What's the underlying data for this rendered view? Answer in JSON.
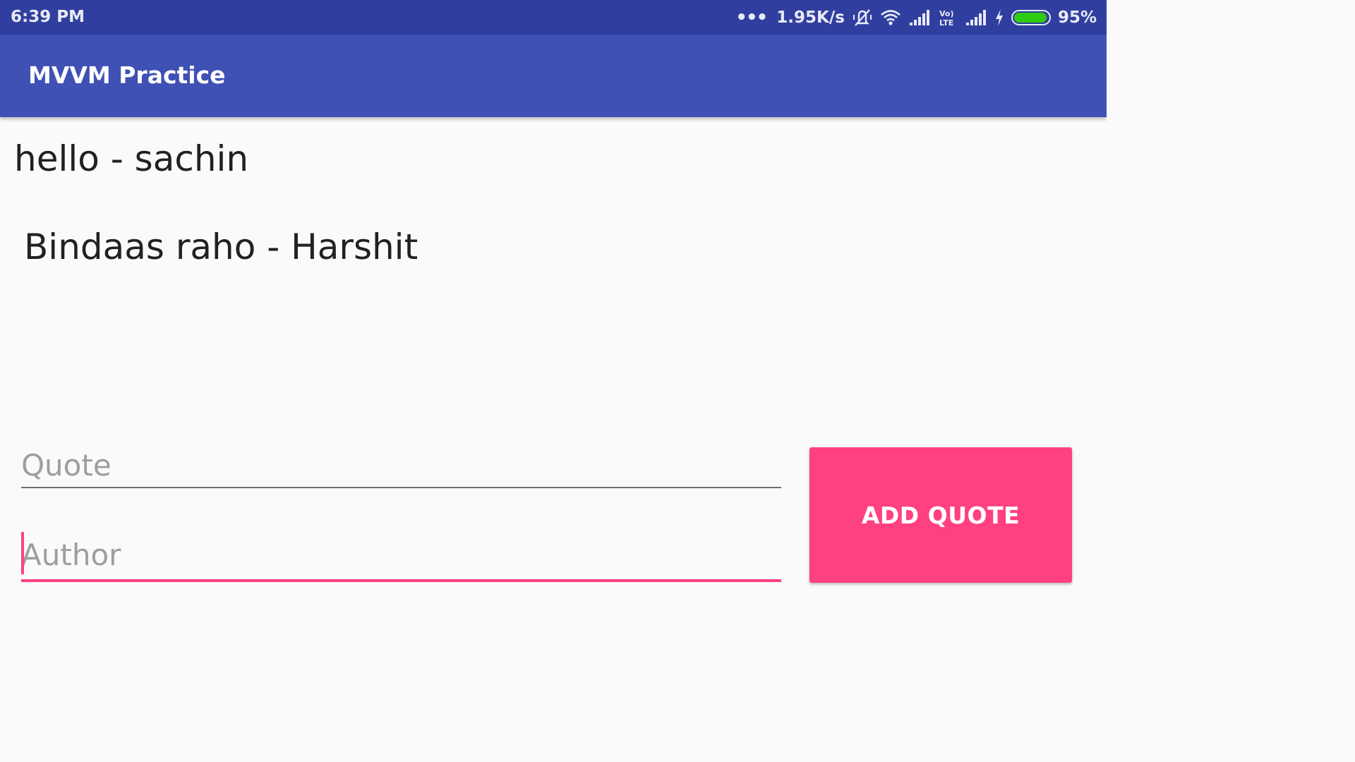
{
  "status_bar": {
    "time": "6:39 PM",
    "network_speed": "1.95K/s",
    "volte_label": "Vo LTE",
    "battery_percent": "95%",
    "battery_level": 0.95,
    "battery_color": "#2ecc11",
    "icons": [
      "more-dots-icon",
      "vibrate-mute-icon",
      "wifi-icon",
      "signal-icon",
      "volte-icon",
      "signal-icon",
      "charging-icon",
      "battery-icon"
    ]
  },
  "app_bar": {
    "title": "MVVM Practice",
    "color": "#3f51b5"
  },
  "quotes": [
    {
      "text": "hello - sachin"
    },
    {
      "text": "Bindaas raho - Harshit"
    }
  ],
  "form": {
    "quote_placeholder": "Quote",
    "quote_value": "",
    "author_placeholder": "Author",
    "author_value": "",
    "accent_color": "#ff4081"
  },
  "add_button": {
    "label": "ADD QUOTE"
  }
}
